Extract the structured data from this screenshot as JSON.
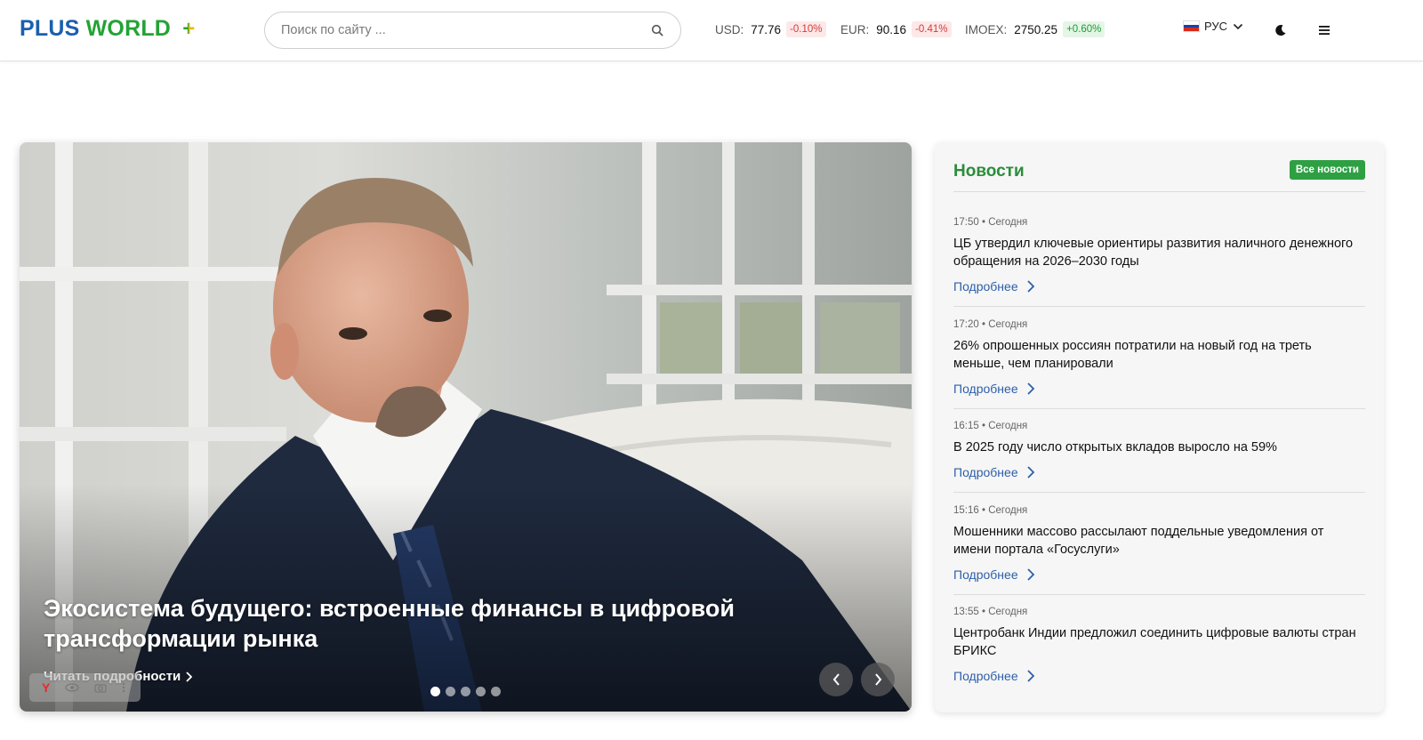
{
  "header": {
    "logo": {
      "plus": "PLUS",
      "world": "WORLD",
      "sign": "+"
    },
    "search": {
      "placeholder": "Поиск по сайту ..."
    },
    "tickers": [
      {
        "label": "USD:",
        "value": "77.76",
        "change": "-0.10%",
        "direction": "down"
      },
      {
        "label": "EUR:",
        "value": "90.16",
        "change": "-0.41%",
        "direction": "down"
      },
      {
        "label": "IMOEX:",
        "value": "2750.25",
        "change": "+0.60%",
        "direction": "up"
      }
    ],
    "language": "РУС"
  },
  "hero": {
    "title": "Экосистема будущего: встроенные финансы в цифровой трансформации рынка",
    "read_more": "Читать подробности",
    "slides_count": 5,
    "active_slide": 1
  },
  "news": {
    "title": "Новости",
    "all_news_label": "Все новости",
    "more_label": "Подробнее",
    "items": [
      {
        "time": "17:50 • Сегодня",
        "headline": "ЦБ утвердил ключевые ориентиры развития наличного денежного обращения на 2026–2030 годы"
      },
      {
        "time": "17:20 • Сегодня",
        "headline": "26% опрошенных россиян потратили на новый год на треть меньше, чем планировали"
      },
      {
        "time": "16:15 • Сегодня",
        "headline": "В 2025 году число открытых вкладов выросло на 59%"
      },
      {
        "time": "15:16 • Сегодня",
        "headline": "Мошенники массово рассылают поддельные уведомления от имени портала «Госуслуги»"
      },
      {
        "time": "13:55 • Сегодня",
        "headline": "Центробанк Индии предложил соединить цифровые валюты стран БРИКС"
      }
    ]
  },
  "colors": {
    "brand_blue": "#1b5fae",
    "brand_green": "#24a336",
    "news_green": "#2a8d3a",
    "link_blue": "#2d5fa8",
    "negative": "#d23b3b",
    "positive": "#1f9a35"
  }
}
